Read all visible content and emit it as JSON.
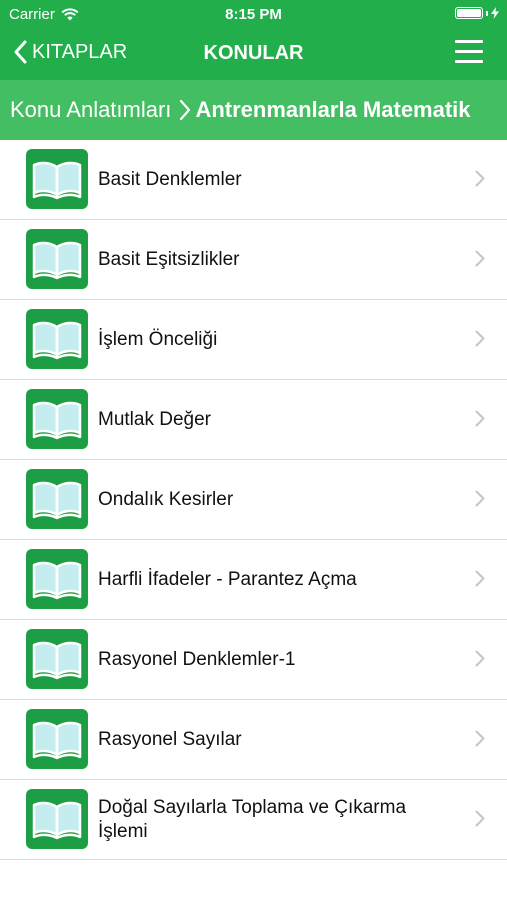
{
  "status_bar": {
    "carrier": "Carrier",
    "time": "8:15 PM"
  },
  "navbar": {
    "back_label": "KITAPLAR",
    "title": "KONULAR"
  },
  "breadcrumb": {
    "parent": "Konu Anlatımları",
    "current": "Antrenmanlarla Matematik"
  },
  "topics": [
    {
      "label": "Basit Denklemler"
    },
    {
      "label": "Basit Eşitsizlikler"
    },
    {
      "label": "İşlem Önceliği"
    },
    {
      "label": "Mutlak Değer"
    },
    {
      "label": "Ondalık Kesirler"
    },
    {
      "label": "Harfli İfadeler - Parantez Açma"
    },
    {
      "label": "Rasyonel Denklemler-1"
    },
    {
      "label": "Rasyonel Sayılar"
    },
    {
      "label": "Doğal Sayılarla Toplama ve Çıkarma İşlemi"
    }
  ],
  "colors": {
    "header": "#21ae4b",
    "breadcrumb": "#44be63",
    "icon_bg": "#1e9e44",
    "book_page": "#c5ecef"
  }
}
